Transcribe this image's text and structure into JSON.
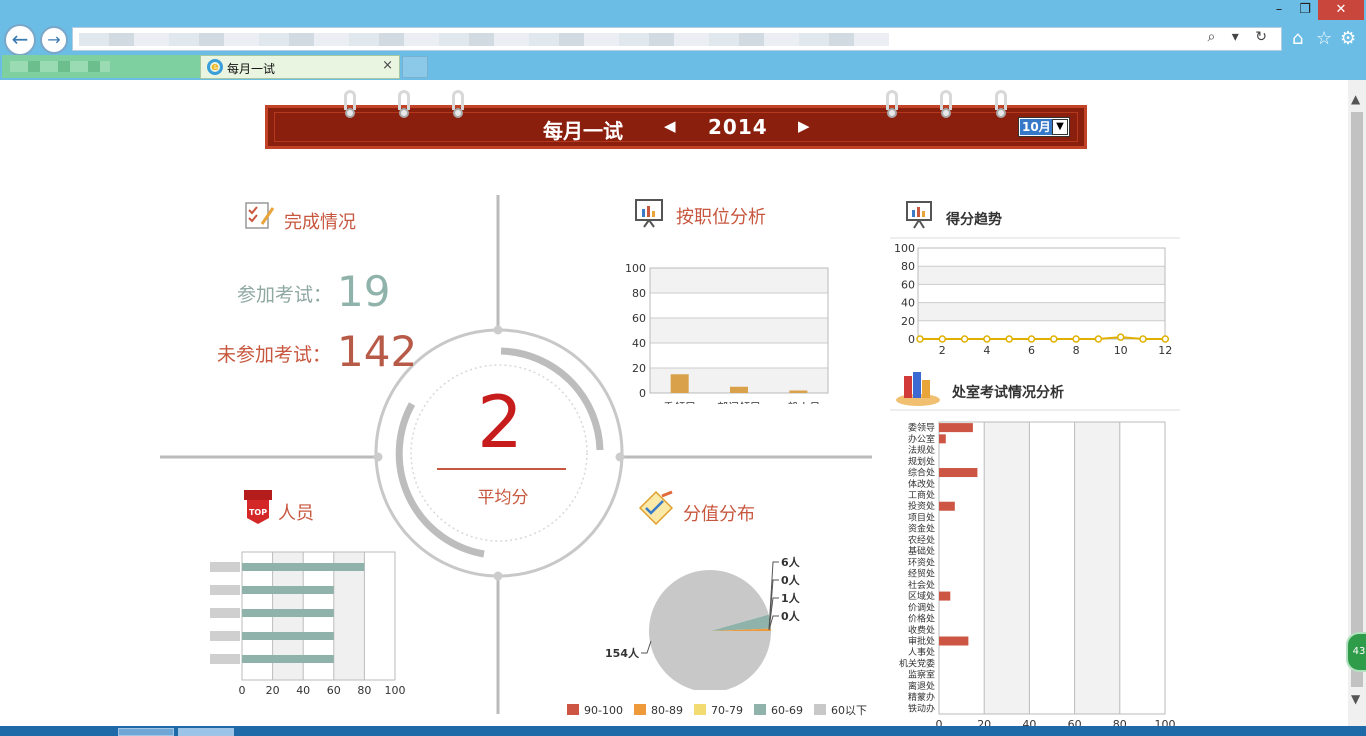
{
  "browser": {
    "tab_active_title": "每月一试",
    "tab_close": "×",
    "back": "←",
    "forward": "→",
    "addr_icons": "⌕ ▾ ↻",
    "win_min": "–",
    "win_max": "❐",
    "win_close": "✕",
    "home_icon": "⌂",
    "star_icon": "☆",
    "gear_icon": "⚙",
    "float_badge": "43"
  },
  "banner": {
    "title": "每月一试",
    "prev": "◀",
    "next": "▶",
    "year": "2014",
    "month_value": "10月"
  },
  "completion": {
    "title": "完成情况",
    "participated_label": "参加考试：",
    "participated_value": "19",
    "not_participated_label": "未参加考试：",
    "not_participated_value": "142"
  },
  "average": {
    "value": "2",
    "label": "平均分"
  },
  "colors": {
    "accent": "#c8573f",
    "gray_teal": "#8fb3aa",
    "bar_orange": "#d9a24a",
    "bar_red": "#cc5544",
    "line_yellow": "#e0b000"
  },
  "charts": {
    "position": {
      "title": "按职位分析",
      "chart_data": {
        "type": "bar",
        "categories": [
          "委领导",
          "部门领导",
          "一般人员"
        ],
        "values": [
          15,
          5,
          2
        ],
        "ylim": [
          0,
          100
        ],
        "yticks": [
          0,
          20,
          40,
          60,
          80,
          100
        ]
      }
    },
    "trend": {
      "title": "得分趋势",
      "chart_data": {
        "type": "line",
        "x": [
          1,
          2,
          3,
          4,
          5,
          6,
          7,
          8,
          9,
          10,
          11,
          12
        ],
        "values": [
          0,
          0,
          0,
          0,
          0,
          0,
          0,
          0,
          0,
          2,
          0,
          0
        ],
        "xticks": [
          2,
          4,
          6,
          8,
          10,
          12
        ],
        "yticks": [
          0,
          20,
          40,
          60,
          80,
          100
        ],
        "ylim": [
          0,
          100
        ]
      }
    },
    "staff": {
      "title": "人员",
      "chart_data": {
        "type": "bar",
        "orientation": "horizontal",
        "values": [
          80,
          60,
          60,
          60,
          60
        ],
        "xticks": [
          0,
          20,
          40,
          60,
          80,
          100
        ],
        "xlim": [
          0,
          100
        ]
      }
    },
    "distribution": {
      "title": "分值分布",
      "chart_data": {
        "type": "pie",
        "labels": [
          "90-100",
          "80-89",
          "70-79",
          "60-69",
          "60以下"
        ],
        "values": [
          0,
          1,
          0,
          6,
          154
        ],
        "value_labels": [
          "0人",
          "1人",
          "0人",
          "6人",
          "154人"
        ],
        "colors": [
          "#cc5544",
          "#ef9a3a",
          "#f2dc72",
          "#8fb3aa",
          "#c8c8c8"
        ]
      }
    },
    "departments": {
      "title": "处室考试情况分析",
      "chart_data": {
        "type": "bar",
        "orientation": "horizontal",
        "categories": [
          "委领导",
          "办公室",
          "法规处",
          "规划处",
          "综合处",
          "体改处",
          "工商处",
          "投资处",
          "项目处",
          "资金处",
          "农经处",
          "基础处",
          "环资处",
          "经贸处",
          "社会处",
          "区域处",
          "价调处",
          "价格处",
          "收费处",
          "审批处",
          "人事处",
          "机关党委",
          "监察室",
          "离退处",
          "精蒙办",
          "铁动办"
        ],
        "values": [
          15,
          3,
          0,
          0,
          17,
          0,
          0,
          7,
          0,
          0,
          0,
          0,
          0,
          0,
          0,
          5,
          0,
          0,
          0,
          13,
          0,
          0,
          0,
          0,
          0,
          0
        ],
        "xticks": [
          0,
          20,
          40,
          60,
          80,
          100
        ],
        "xlim": [
          0,
          100
        ]
      }
    }
  }
}
